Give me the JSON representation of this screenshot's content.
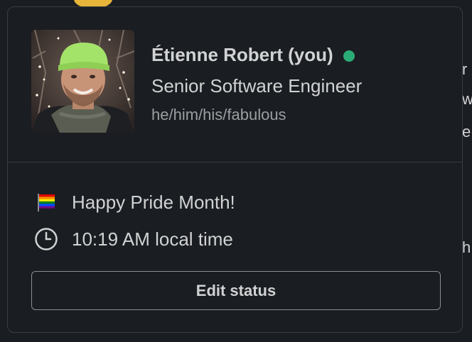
{
  "background": {
    "edge_letters": [
      "r",
      "w",
      "e",
      "h"
    ]
  },
  "profile": {
    "name": "Étienne Robert (you)",
    "presence": "active",
    "title": "Senior Software Engineer",
    "pronouns": "he/him/his/fabulous",
    "avatar_icon": "user-photo"
  },
  "status": {
    "emoji_icon": "rainbow-flag-icon",
    "text": "Happy Pride Month!"
  },
  "local_time": {
    "icon": "clock-icon",
    "text": "10:19 AM local time"
  },
  "actions": {
    "edit_status_label": "Edit status"
  },
  "colors": {
    "background": "#1a1d21",
    "text": "#d1d2d3",
    "muted": "#9c9ea1",
    "presence_active": "#2bac76",
    "border": "#3a3c40"
  }
}
